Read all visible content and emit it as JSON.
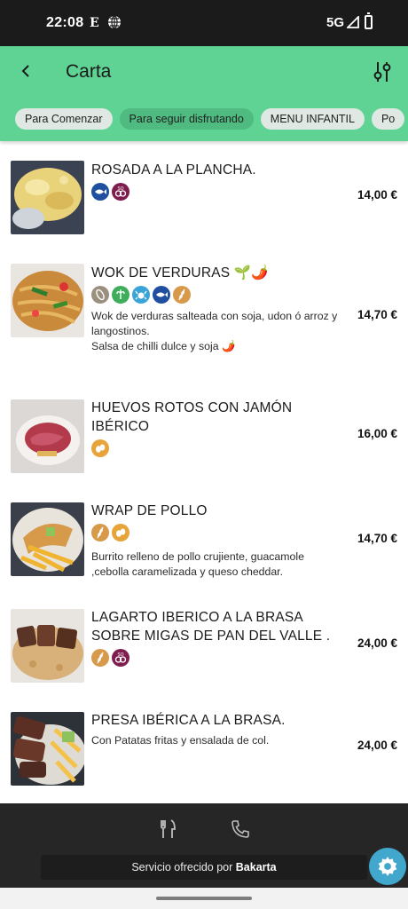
{
  "status_bar": {
    "time": "22:08",
    "carrier_letter": "E",
    "network": "5G"
  },
  "header": {
    "title": "Carta"
  },
  "tabs": [
    {
      "label": "Para Comenzar",
      "active": false
    },
    {
      "label": "Para seguir disfrutando",
      "active": true
    },
    {
      "label": "MENU INFANTIL",
      "active": false
    },
    {
      "label": "Po",
      "active": false
    }
  ],
  "items": [
    {
      "name": "ROSADA A LA PLANCHA.",
      "description": "",
      "price": "14,00 €",
      "allergens": [
        "fish-icon",
        "sulphites-icon"
      ]
    },
    {
      "name": "WOK DE VERDURAS 🌱🌶️",
      "description": "Wok de verduras salteada con soja, udon ó arroz y langostinos.\nSalsa de chilli dulce y soja 🌶️",
      "price": "14,70 €",
      "allergens": [
        "peanut-icon",
        "celery-icon",
        "crustacean-icon",
        "fish-icon",
        "gluten-icon"
      ]
    },
    {
      "name": "HUEVOS ROTOS CON JAMÓN IBÉRICO",
      "description": "",
      "price": "16,00 €",
      "allergens": [
        "egg-icon"
      ]
    },
    {
      "name": "WRAP DE POLLO",
      "description": "Burrito relleno de pollo crujiente, guacamole ,cebolla caramelizada y queso cheddar.",
      "price": "14,70 €",
      "allergens": [
        "gluten-icon",
        "egg-icon"
      ]
    },
    {
      "name": "LAGARTO IBERICO A LA BRASA SOBRE MIGAS DE PAN DEL VALLE .",
      "description": "",
      "price": "24,00 €",
      "allergens": [
        "gluten-icon",
        "sulphites-icon"
      ]
    },
    {
      "name": "PRESA IBÉRICA A LA BRASA.",
      "description": "Con Patatas fritas y ensalada de col.",
      "price": "24,00 €",
      "allergens": []
    }
  ],
  "footer": {
    "service_text": "Servicio ofrecido por ",
    "brand": "Bakarta"
  },
  "allergen_colors": {
    "fish-icon": "#1f4f9e",
    "sulphites-icon": "#7f1d4e",
    "peanut-icon": "#9b8f7e",
    "celery-icon": "#3fae5c",
    "crustacean-icon": "#3aa3d8",
    "gluten-icon": "#d79a4a",
    "egg-icon": "#e7a43a"
  },
  "colors": {
    "header": "#5fd393",
    "active_tab": "#4fbb80",
    "fab": "#42a7cc"
  }
}
